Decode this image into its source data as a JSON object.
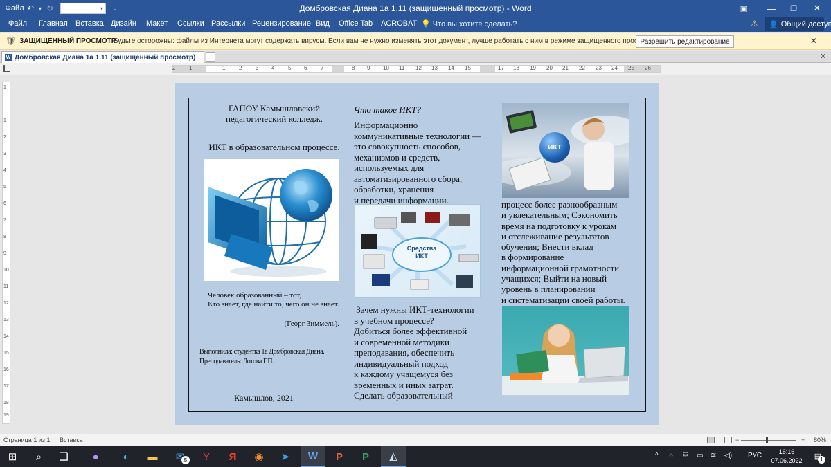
{
  "titlebar": {
    "file_label": "Файл",
    "window_title": "Домбровская Диана 1а 1.11 (защищенный просмотр)  -  Word",
    "save_icon": "save-icon",
    "undo_icon": "undo-icon",
    "redo_icon": "redo-icon"
  },
  "ribbon": {
    "tabs": [
      "Файл",
      "Главная",
      "Вставка",
      "Дизайн",
      "Макет",
      "Ссылки",
      "Рассылки",
      "Рецензирование",
      "Вид",
      "Office Tab",
      "ACROBAT"
    ],
    "search_placeholder": "Что вы хотите сделать?",
    "share_label": "Общий доступ"
  },
  "protected_view": {
    "label": "ЗАЩИЩЕННЫЙ ПРОСМОТР",
    "message": "Будьте осторожны: файлы из Интернета могут содержать вирусы. Если вам не нужно изменять этот документ, лучше работать с ним в режиме защищенного просмотра.",
    "enable_button": "Разрешить редактирование"
  },
  "document_tab": {
    "label": "Домбровская Диана 1а 1.11 (защищенный просмотр)"
  },
  "ruler": {
    "numbers": [
      "2",
      "1",
      "1",
      "2",
      "3",
      "4",
      "5",
      "6",
      "7",
      "8",
      "9",
      "10",
      "11",
      "12",
      "13",
      "14",
      "15",
      "16",
      "17",
      "18",
      "19",
      "20",
      "21",
      "22",
      "23",
      "24",
      "25",
      "26",
      "27"
    ],
    "vertical_numbers": [
      "1",
      "1",
      "2",
      "3",
      "4",
      "5",
      "6",
      "7",
      "8",
      "9",
      "10",
      "11",
      "12",
      "13",
      "14",
      "15",
      "16",
      "17",
      "18",
      "19"
    ]
  },
  "doc": {
    "col1": {
      "title_line1": "ГАПОУ Камышловский",
      "title_line2": "педагогический колледж.",
      "subtitle": "ИКТ в образовательном процессе.",
      "quote_line1": "Человек образованный – тот,",
      "quote_line2": "Кто знает, где найти то, чего он не знает.",
      "quote_author": "(Георг Зиммель).",
      "credit_line1": "Выполнила: студентка 1а Домбровская Диана.",
      "credit_line2": "Преподаватель: Лотова Г.П.",
      "city_year": "Камышлов, 2021"
    },
    "col2": {
      "heading": "Что такое ИКТ?",
      "body_lines": [
        "Информационно",
        "коммуникативные технологии —",
        "это совокупность способов,",
        "механизмов и средств,",
        "используемых для",
        "автоматизированного сбора,",
        "обработки, хранения",
        "и передачи информации."
      ],
      "diagram_label_line1": "Средства",
      "diagram_label_line2": "ИКТ",
      "body2_lines": [
        " Зачем нужны ИКТ-технологии",
        "в учебном процессе?",
        "Добиться более эффективной",
        "и современной методики",
        "преподавания, обеспечить",
        "индивидуальный подход",
        "к каждому учащемуся без",
        "временных и иных затрат.",
        "Сделать образовательный"
      ]
    },
    "col3": {
      "image_badge": "ИКТ",
      "body_lines": [
        "процесс более разнообразным",
        "и увлекательным; Сэкономить",
        "время на подготовку к урокам",
        "и отслеживание результатов",
        "обучения; Внести вклад",
        "в формирование",
        "информационной грамотности",
        "учащихся; Выйти на новый",
        "уровень в планировании",
        "и систематизации своей работы."
      ]
    }
  },
  "statusbar": {
    "page_info": "Страница 1 из 1",
    "mode": "Вставка",
    "zoom": "80%"
  },
  "taskbar": {
    "lang": "РУС",
    "time": "16:16",
    "date": "07.06.2022",
    "mail_badge": "5",
    "notif_count": "1"
  }
}
